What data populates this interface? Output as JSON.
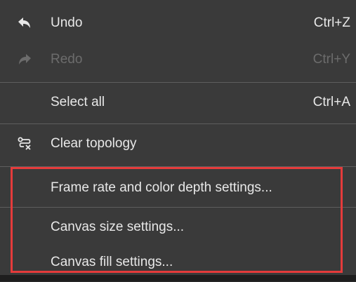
{
  "menu": {
    "items": [
      {
        "label": "Undo",
        "shortcut": "Ctrl+Z",
        "icon": "undo-icon",
        "enabled": true
      },
      {
        "label": "Redo",
        "shortcut": "Ctrl+Y",
        "icon": "redo-icon",
        "enabled": false
      },
      {
        "label": "Select all",
        "shortcut": "Ctrl+A",
        "icon": null,
        "enabled": true
      },
      {
        "label": "Clear topology",
        "shortcut": "",
        "icon": "clear-topology-icon",
        "enabled": true
      },
      {
        "label": "Frame rate and color depth settings...",
        "shortcut": "",
        "icon": null,
        "enabled": true
      },
      {
        "label": "Canvas size settings...",
        "shortcut": "",
        "icon": null,
        "enabled": true
      },
      {
        "label": "Canvas fill settings...",
        "shortcut": "",
        "icon": null,
        "enabled": true
      }
    ]
  },
  "colors": {
    "menu_background": "#3a3a3a",
    "text": "#e8e8e8",
    "disabled_text": "#6c6c6c",
    "separator": "#5e5e5e",
    "highlight_border": "#e53b3b"
  }
}
